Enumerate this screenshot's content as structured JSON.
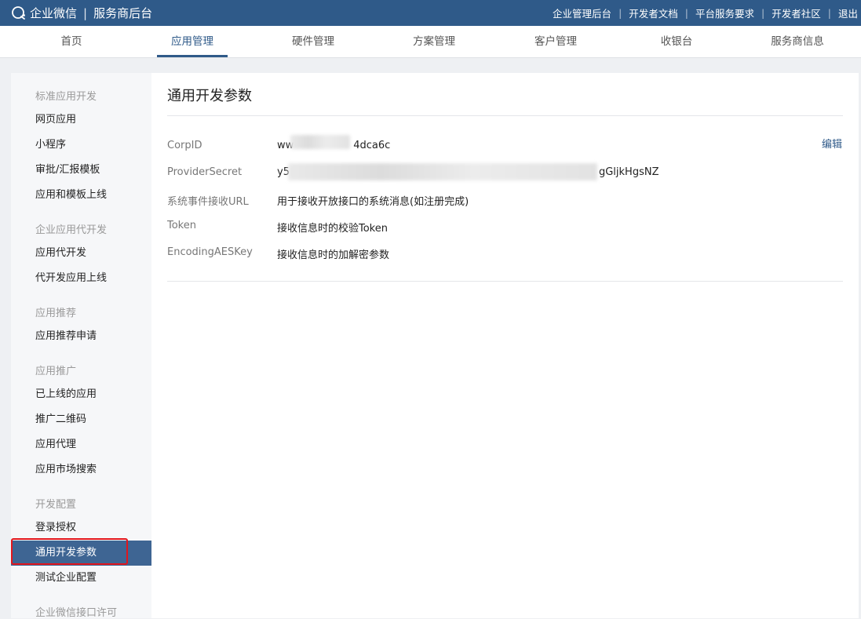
{
  "topbar": {
    "brand_name": "企业微信",
    "brand_separator": "|",
    "section_name": "服务商后台",
    "links": [
      "企业管理后台",
      "开发者文档",
      "平台服务要求",
      "开发者社区",
      "退出"
    ]
  },
  "main_nav": {
    "items": [
      "首页",
      "应用管理",
      "硬件管理",
      "方案管理",
      "客户管理",
      "收银台",
      "服务商信息"
    ],
    "active": "应用管理"
  },
  "sidebar": {
    "groups": [
      {
        "title": "标准应用开发",
        "items": [
          "网页应用",
          "小程序",
          "审批/汇报模板",
          "应用和模板上线"
        ]
      },
      {
        "title": "企业应用代开发",
        "items": [
          "应用代开发",
          "代开发应用上线"
        ]
      },
      {
        "title": "应用推荐",
        "items": [
          "应用推荐申请"
        ]
      },
      {
        "title": "应用推广",
        "items": [
          "已上线的应用",
          "推广二维码",
          "应用代理",
          "应用市场搜索"
        ]
      },
      {
        "title": "开发配置",
        "items": [
          "登录授权",
          "通用开发参数",
          "测试企业配置"
        ]
      },
      {
        "title": "企业微信接口许可",
        "items": []
      }
    ],
    "active_item": "通用开发参数"
  },
  "content": {
    "title": "通用开发参数",
    "edit_label": "编辑",
    "rows": [
      {
        "label": "CorpID",
        "value_prefix": "ww",
        "value_suffix": "4dca6c"
      },
      {
        "label": "ProviderSecret",
        "value_prefix": "y5",
        "value_suffix": "gGljkHgsNZ"
      },
      {
        "label": "系统事件接收URL",
        "value": "用于接收开放接口的系统消息(如注册完成)"
      },
      {
        "label": "Token",
        "value": "接收信息时的校验Token"
      },
      {
        "label": "EncodingAESKey",
        "value": "接收信息时的加解密参数"
      }
    ]
  },
  "colors": {
    "topbar_bg": "#2f5a89",
    "active_sidebar_bg": "#3e6593",
    "highlight_border": "#e2161c"
  }
}
